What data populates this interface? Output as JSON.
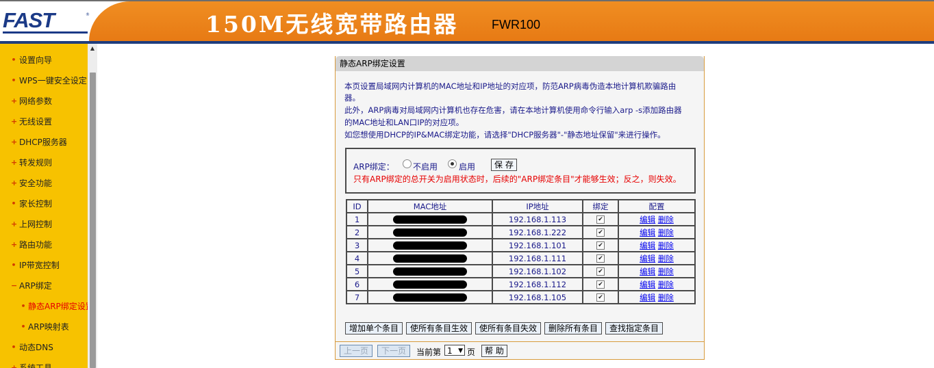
{
  "header": {
    "logo": "FAST",
    "logo_reg": "®",
    "product": "150M无线宽带路由器",
    "model": "FWR100",
    "colors": {
      "brand_blue": "#1b3a87",
      "header_orange": "#ec8419"
    }
  },
  "sidebar": {
    "items": [
      {
        "label": "设置向导",
        "marker": "•"
      },
      {
        "label": "WPS一键安全设定",
        "marker": "•"
      },
      {
        "label": "网络参数",
        "marker": "+"
      },
      {
        "label": "无线设置",
        "marker": "+"
      },
      {
        "label": "DHCP服务器",
        "marker": "+"
      },
      {
        "label": "转发规则",
        "marker": "+"
      },
      {
        "label": "安全功能",
        "marker": "+"
      },
      {
        "label": "家长控制",
        "marker": "•"
      },
      {
        "label": "上网控制",
        "marker": "+"
      },
      {
        "label": "路由功能",
        "marker": "+"
      },
      {
        "label": "IP带宽控制",
        "marker": "•"
      },
      {
        "label": "ARP绑定",
        "marker": "−"
      },
      {
        "label": "静态ARP绑定设置",
        "marker": "•"
      },
      {
        "label": "ARP映射表",
        "marker": "•"
      },
      {
        "label": "动态DNS",
        "marker": "•"
      },
      {
        "label": "系统工具",
        "marker": "+"
      }
    ]
  },
  "panel": {
    "title": "静态ARP绑定设置",
    "desc_line1": "本页设置局域网内计算机的MAC地址和IP地址的对应项，防范ARP病毒伪造本地计算机欺骗路由",
    "desc_line2": "器。",
    "desc_line3": "此外，ARP病毒对局域网内计算机也存在危害，请在本地计算机使用命令行输入arp -s添加路由器",
    "desc_line4": "的MAC地址和LAN口IP的对应项。",
    "desc_line5": "如您想使用DHCP的IP&MAC绑定功能，请选择\"DHCP服务器\"-\"静态地址保留\"来进行操作。",
    "arp_binding_label": "ARP绑定：",
    "radio_disable": "不启用",
    "radio_enable": "启用",
    "arp_enabled": true,
    "save_label": "保 存",
    "warning": "只有ARP绑定的总开关为启用状态时，后续的\"ARP绑定条目\"才能够生效；反之，则失效。"
  },
  "table": {
    "headers": [
      "ID",
      "MAC地址",
      "IP地址",
      "绑定",
      "配置"
    ],
    "edit_label": "编辑",
    "delete_label": "删除",
    "rows": [
      {
        "id": "1",
        "ip": "192.168.1.113",
        "bound": true
      },
      {
        "id": "2",
        "ip": "192.168.1.222",
        "bound": true
      },
      {
        "id": "3",
        "ip": "192.168.1.101",
        "bound": true
      },
      {
        "id": "4",
        "ip": "192.168.1.111",
        "bound": true
      },
      {
        "id": "5",
        "ip": "192.168.1.102",
        "bound": true
      },
      {
        "id": "6",
        "ip": "192.168.1.112",
        "bound": true
      },
      {
        "id": "7",
        "ip": "192.168.1.105",
        "bound": true
      }
    ]
  },
  "actions": {
    "add_single": "增加单个条目",
    "enable_all": "使所有条目生效",
    "disable_all": "使所有条目失效",
    "delete_all": "删除所有条目",
    "find_entry": "查找指定条目"
  },
  "pager": {
    "prev": "上一页",
    "next": "下一页",
    "current_prefix": "当前第",
    "current_page": "1",
    "page_suffix": "页",
    "help": "帮 助"
  }
}
